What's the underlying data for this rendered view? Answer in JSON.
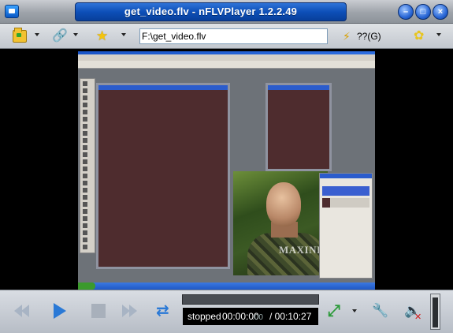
{
  "window": {
    "title": "get_video.flv - nFLVPlayer 1.2.2.49",
    "buttons": [
      "minimize",
      "maximize",
      "close"
    ]
  },
  "toolbar": {
    "url_value": "F:\\get_video.flv",
    "help_label": "??(G)",
    "icons": [
      "folder-open-icon",
      "link-icon",
      "favorites-star-icon",
      "lightning-icon",
      "skin-flower-icon"
    ]
  },
  "video": {
    "watermark_text": "MAXINISM"
  },
  "controls": {
    "status": "stopped",
    "current_time": "00:00:00",
    "current_ms": ".00",
    "total_time": "/ 00:10:27",
    "volume_level": 0.95,
    "seek_progress": 0
  }
}
